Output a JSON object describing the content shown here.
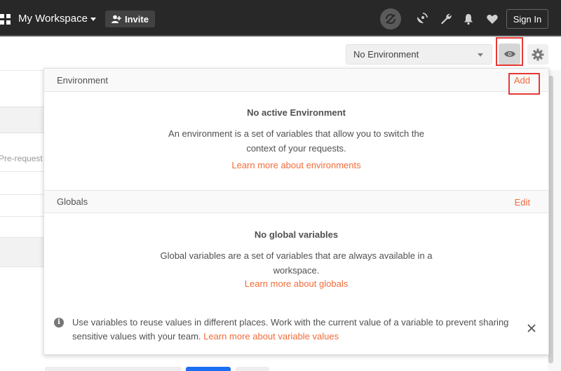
{
  "topbar": {
    "workspace_title": "My Workspace",
    "invite_label": "Invite",
    "sign_in_label": "Sign In",
    "icons": [
      "grid-icon",
      "sync-off-icon",
      "satellite-icon",
      "wrench-icon",
      "bell-icon",
      "heart-icon"
    ]
  },
  "env_bar": {
    "selected_environment": "No Environment"
  },
  "background": {
    "prerequest_fragment": "Pre-request"
  },
  "popover": {
    "environment": {
      "header": "Environment",
      "add_label": "Add",
      "empty_title": "No active Environment",
      "desc_line1": "An environment is a set of variables that allow you to switch the",
      "desc_line2": "context of your requests.",
      "learn_more": "Learn more about environments"
    },
    "globals": {
      "header": "Globals",
      "edit_label": "Edit",
      "empty_title": "No global variables",
      "desc_line1": "Global variables are a set of variables that are always available in a",
      "desc_line2": "workspace.",
      "learn_more": "Learn more about globals"
    },
    "tip": {
      "text": "Use variables to reuse values in different places. Work with the current value of a variable to prevent sharing sensitive values with your team.",
      "link": "Learn more about variable values"
    }
  },
  "colors": {
    "topbar_bg": "#282828",
    "accent_link": "#f26b3a",
    "highlight_box": "#e53935",
    "primary_button": "#1b6ff0"
  }
}
